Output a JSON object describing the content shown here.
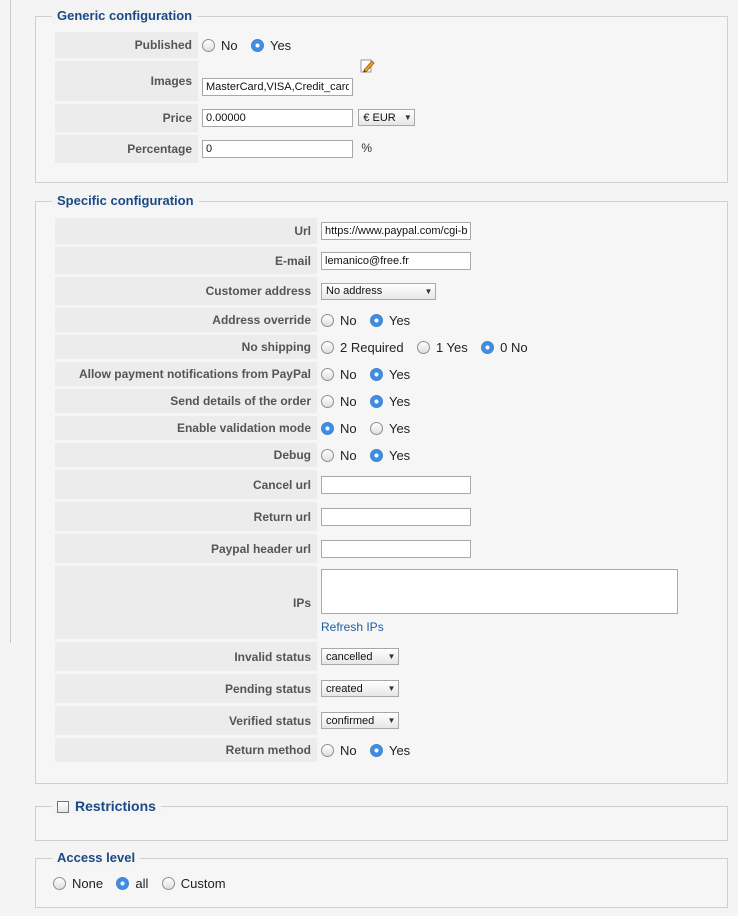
{
  "generic": {
    "legend": "Generic configuration",
    "published": {
      "label": "Published",
      "options": [
        "No",
        "Yes"
      ]
    },
    "images": {
      "label": "Images",
      "value": "MasterCard,VISA,Credit_card"
    },
    "price": {
      "label": "Price",
      "value": "0.00000",
      "currency": "€ EUR"
    },
    "percentage": {
      "label": "Percentage",
      "value": "0",
      "unit": "%"
    }
  },
  "specific": {
    "legend": "Specific configuration",
    "url": {
      "label": "Url",
      "value": "https://www.paypal.com/cgi-bin/webscr"
    },
    "email": {
      "label": "E-mail",
      "value": "lemanico@free.fr"
    },
    "customer_address": {
      "label": "Customer address",
      "value": "No address"
    },
    "address_override": {
      "label": "Address override",
      "options": [
        "No",
        "Yes"
      ]
    },
    "no_shipping": {
      "label": "No shipping",
      "options": [
        "2 Required",
        "1 Yes",
        "0 No"
      ]
    },
    "allow_notifications": {
      "label": "Allow payment notifications from PayPal",
      "options": [
        "No",
        "Yes"
      ]
    },
    "send_details": {
      "label": "Send details of the order",
      "options": [
        "No",
        "Yes"
      ]
    },
    "validation_mode": {
      "label": "Enable validation mode",
      "options": [
        "No",
        "Yes"
      ]
    },
    "debug": {
      "label": "Debug",
      "options": [
        "No",
        "Yes"
      ]
    },
    "cancel_url": {
      "label": "Cancel url",
      "value": ""
    },
    "return_url": {
      "label": "Return url",
      "value": ""
    },
    "header_url": {
      "label": "Paypal header url",
      "value": ""
    },
    "ips": {
      "label": "IPs",
      "value": "",
      "refresh": "Refresh IPs"
    },
    "invalid_status": {
      "label": "Invalid status",
      "value": "cancelled"
    },
    "pending_status": {
      "label": "Pending status",
      "value": "created"
    },
    "verified_status": {
      "label": "Verified status",
      "value": "confirmed"
    },
    "return_method": {
      "label": "Return method",
      "options": [
        "No",
        "Yes"
      ]
    }
  },
  "restrictions": {
    "legend": "Restrictions"
  },
  "access": {
    "legend": "Access level",
    "options": [
      "None",
      "all",
      "Custom"
    ]
  },
  "icons": {
    "edit": "pencil-icon",
    "dropdown": "chevron-down-icon"
  }
}
